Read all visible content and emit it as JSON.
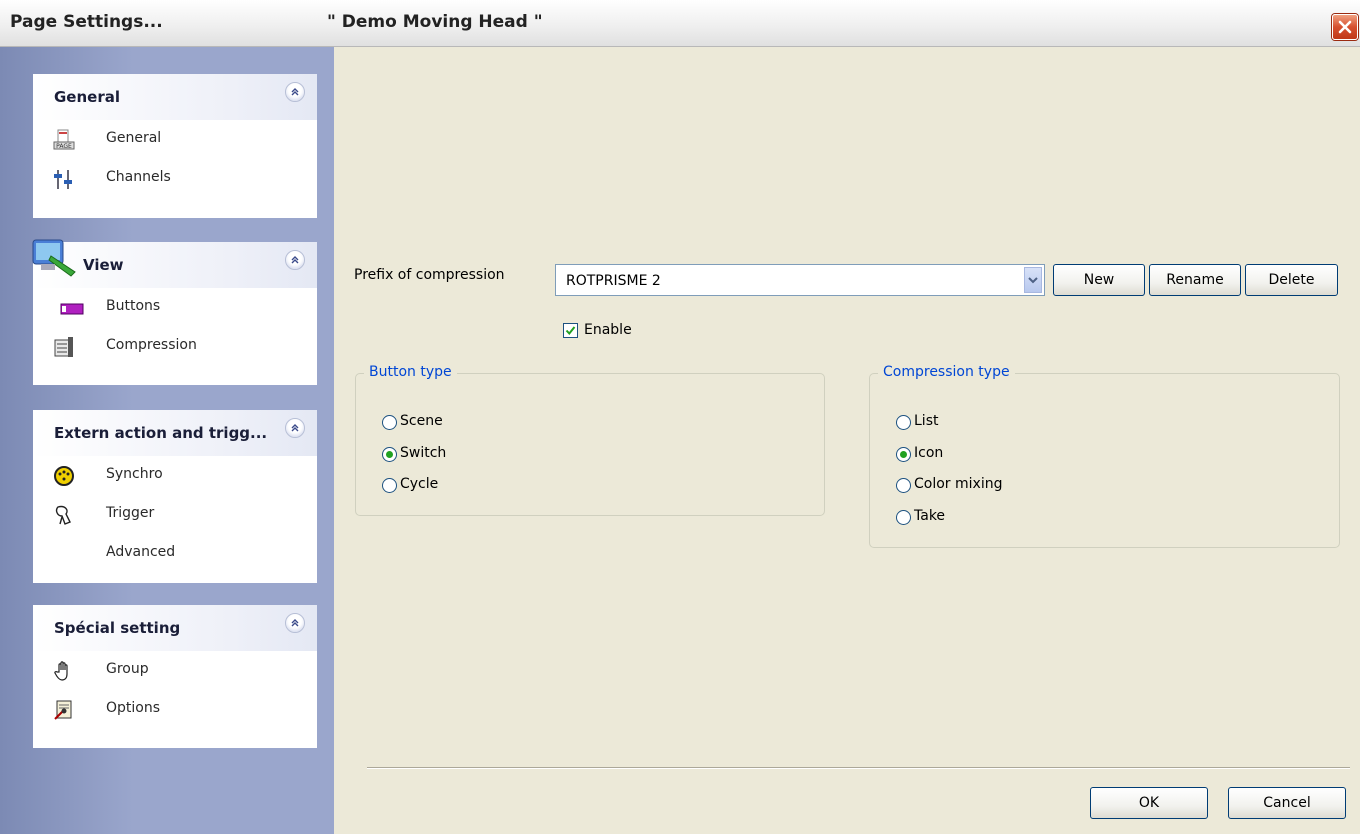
{
  "window": {
    "title": "Page Settings...",
    "page_name": "\" Demo Moving Head \""
  },
  "sidebar": {
    "groups": [
      {
        "title": "General",
        "items": [
          {
            "label": "General",
            "icon": "page-icon"
          },
          {
            "label": "Channels",
            "icon": "faders-icon"
          }
        ]
      },
      {
        "title": "View",
        "items": [
          {
            "label": "Buttons",
            "icon": "button-icon"
          },
          {
            "label": "Compression",
            "icon": "compression-icon"
          }
        ]
      },
      {
        "title": "Extern action and trigg...",
        "items": [
          {
            "label": "Synchro",
            "icon": "dmx-connector-icon"
          },
          {
            "label": "Trigger",
            "icon": "trigger-icon"
          },
          {
            "label": "Advanced",
            "icon": ""
          }
        ]
      },
      {
        "title": "Spécial setting",
        "items": [
          {
            "label": "Group",
            "icon": "hand-icon"
          },
          {
            "label": "Options",
            "icon": "options-icon"
          }
        ]
      }
    ]
  },
  "form": {
    "prefix_label": "Prefix of compression",
    "prefix_value": "ROTPRISME 2",
    "new_label": "New",
    "rename_label": "Rename",
    "delete_label": "Delete",
    "enable_label": "Enable",
    "enable_checked": true,
    "button_type": {
      "title": "Button type",
      "options": [
        "Scene",
        "Switch",
        "Cycle"
      ],
      "selected": "Switch"
    },
    "compression_type": {
      "title": "Compression type",
      "options": [
        "List",
        "Icon",
        "Color mixing",
        "Take"
      ],
      "selected": "Icon"
    }
  },
  "footer": {
    "ok_label": "OK",
    "cancel_label": "Cancel"
  },
  "colors": {
    "legend_text": "#0046d5",
    "radio_dot": "#21a121",
    "close_button": "#d65030"
  }
}
